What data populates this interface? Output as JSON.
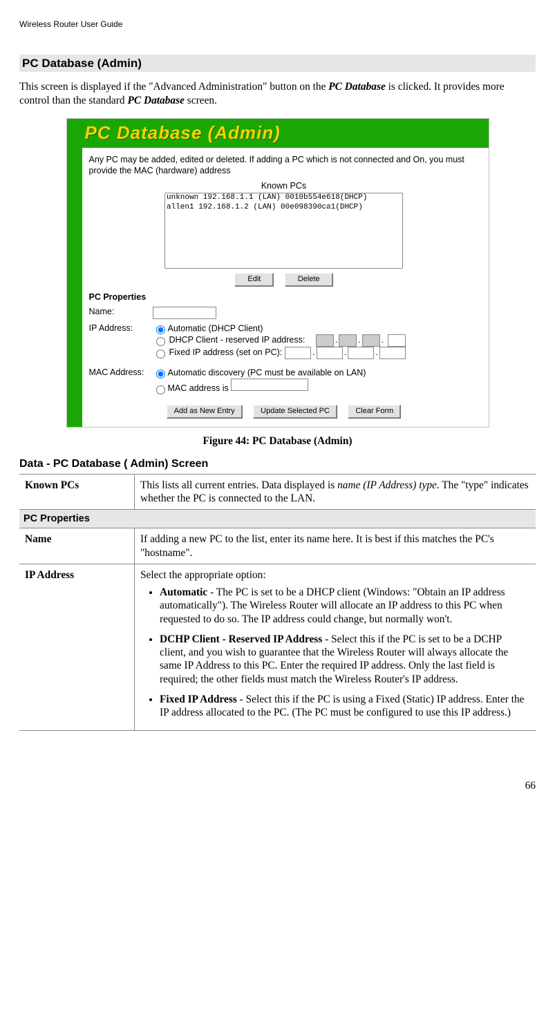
{
  "header": {
    "running": "Wireless Router User Guide"
  },
  "section": {
    "title": "PC Database (Admin)"
  },
  "intro": {
    "part1": "This screen is displayed if the \"Advanced Administration\" button on the ",
    "em1": "PC Database",
    "part2": " is clicked. It provides more control than the standard ",
    "em2": "PC Database",
    "part3": " screen."
  },
  "fig": {
    "title": "PC Database (Admin)",
    "note": "Any PC may be added, edited or deleted. If adding a PC which is not connected and On, you must provide the MAC (hardware) address",
    "known_label": "Known PCs",
    "list": [
      "unknown 192.168.1.1 (LAN) 0010b554e618(DHCP)",
      "allen1 192.168.1.2 (LAN) 00e098390ca1(DHCP)"
    ],
    "buttons": {
      "edit": "Edit",
      "delete": "Delete"
    },
    "props_heading": "PC Properties",
    "name_label": "Name:",
    "ip_label": "IP Address:",
    "ip_opt_auto": "Automatic (DHCP Client)",
    "ip_opt_dhcp": "DHCP Client - reserved IP address:",
    "ip_opt_fixed": "Fixed IP address (set on PC):",
    "mac_label": "MAC Address:",
    "mac_opt_auto": "Automatic discovery (PC must be available on LAN)",
    "mac_opt_is": "MAC address is",
    "bottom_buttons": {
      "add": "Add as New Entry",
      "update": "Update Selected PC",
      "clear": "Clear Form"
    }
  },
  "figcap": "Figure 44: PC Database (Admin)",
  "subsection": "Data - PC Database ( Admin) Screen",
  "table": {
    "known_pcs": {
      "label": "Known PCs",
      "text_a": "This lists all current entries. Data displayed is ",
      "text_em": "name (IP Address) type",
      "text_b": ". The \"type\" indicates whether the PC is connected to the LAN."
    },
    "group_header": "PC Properties",
    "name": {
      "label": "Name",
      "text": "If adding a new PC to the list, enter its name here. It is best if this matches the PC's \"hostname\"."
    },
    "ip": {
      "label": "IP Address",
      "lead": "Select the appropriate option:",
      "b1_head": "Automatic",
      "b1_rest": " - The PC is set to be a DHCP client (Windows: \"Obtain an IP address automatically\"). The Wireless Router will allocate an IP address to this PC when requested to do so. The IP address could change, but normally won't.",
      "b2_head": "DCHP Client - Reserved IP Address",
      "b2_rest": " - Select this if the PC is set to be a DCHP client, and you wish to guarantee that the Wireless Router will always allocate the same IP Address to this PC. Enter the required IP address. Only the last field is required; the other fields must match the Wireless Router's IP address.",
      "b3_head": "Fixed IP Address",
      "b3_rest": " - Select this if the PC is using a Fixed (Static) IP address. Enter the IP address allocated to the PC. (The PC must be configured to use this IP address.)"
    }
  },
  "page_number": "66"
}
